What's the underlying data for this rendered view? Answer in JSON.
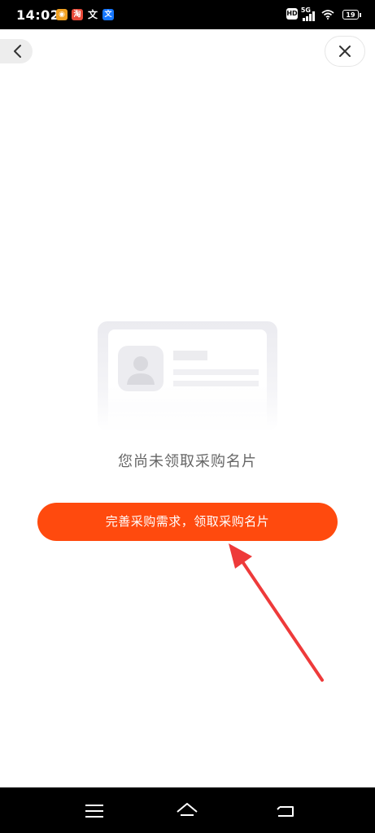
{
  "status_bar": {
    "time": "14:02",
    "network": "5G",
    "hd": "HD",
    "battery": "19",
    "app_icons": [
      {
        "name": "weibo-icon",
        "color": "#f0a020",
        "glyph": "◉"
      },
      {
        "name": "taobao-icon",
        "color": "#e84a3a",
        "glyph": "淘"
      },
      {
        "name": "translate-icon",
        "color": "#000000",
        "glyph": "文"
      },
      {
        "name": "alipay-icon",
        "color": "#1677ff",
        "glyph": "文"
      }
    ]
  },
  "header": {
    "back_icon": "chevron-left-icon",
    "close_icon": "close-icon"
  },
  "main": {
    "illustration": "business-card-placeholder",
    "empty_message": "您尚未领取采购名片",
    "cta_label": "完善采购需求，领取采购名片",
    "accent_color": "#ff4a0e"
  },
  "nav_bar": {
    "items": [
      "menu-icon",
      "home-icon",
      "back-icon"
    ]
  }
}
